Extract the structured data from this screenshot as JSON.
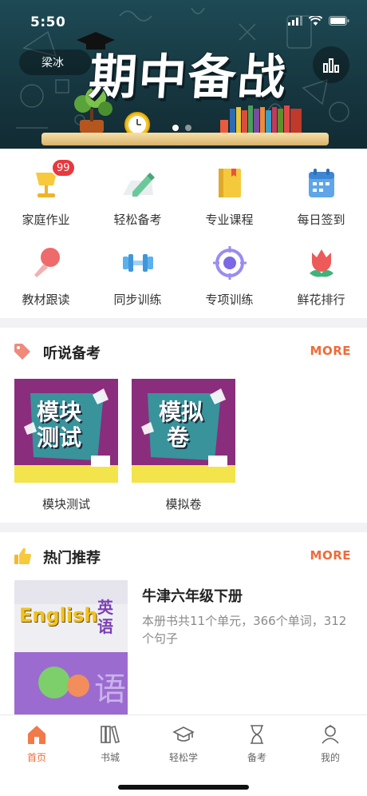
{
  "status_bar": {
    "time": "5:50"
  },
  "banner": {
    "user_name": "梁冰",
    "title": "期中备战",
    "carousel_total": 2,
    "carousel_active": 1
  },
  "menu": [
    {
      "label": "家庭作业",
      "icon": "lamp-icon",
      "badge": "99"
    },
    {
      "label": "轻松备考",
      "icon": "pencil-icon"
    },
    {
      "label": "专业课程",
      "icon": "book-icon"
    },
    {
      "label": "每日签到",
      "icon": "calendar-icon"
    },
    {
      "label": "教材跟读",
      "icon": "microphone-icon"
    },
    {
      "label": "同步训练",
      "icon": "dumbbell-icon"
    },
    {
      "label": "专项训练",
      "icon": "target-icon"
    },
    {
      "label": "鲜花排行",
      "icon": "flower-icon"
    }
  ],
  "listening_section": {
    "title": "听说备考",
    "more": "MORE",
    "items": [
      {
        "label": "模块测试",
        "cover_text": [
          "模块",
          "测试"
        ]
      },
      {
        "label": "模拟卷",
        "cover_text": [
          "模拟",
          "卷"
        ]
      }
    ]
  },
  "recommend_section": {
    "title": "热门推荐",
    "more": "MORE",
    "item": {
      "title": "牛津六年级下册",
      "description": "本册书共11个单元，366个单词，312个句子",
      "cover_en": "English",
      "cover_cn": [
        "英",
        "语"
      ]
    }
  },
  "tabs": [
    {
      "label": "首页",
      "icon": "home-icon",
      "active": true
    },
    {
      "label": "书城",
      "icon": "bookshelf-icon",
      "active": false
    },
    {
      "label": "轻松学",
      "icon": "graduation-cap-icon",
      "active": false
    },
    {
      "label": "备考",
      "icon": "hourglass-icon",
      "active": false
    },
    {
      "label": "我的",
      "icon": "profile-icon",
      "active": false
    }
  ],
  "colors": {
    "accent": "#f06b3a",
    "badge": "#e8383d",
    "module_purple": "#8a2d7d",
    "module_yellow": "#f2e44a"
  }
}
